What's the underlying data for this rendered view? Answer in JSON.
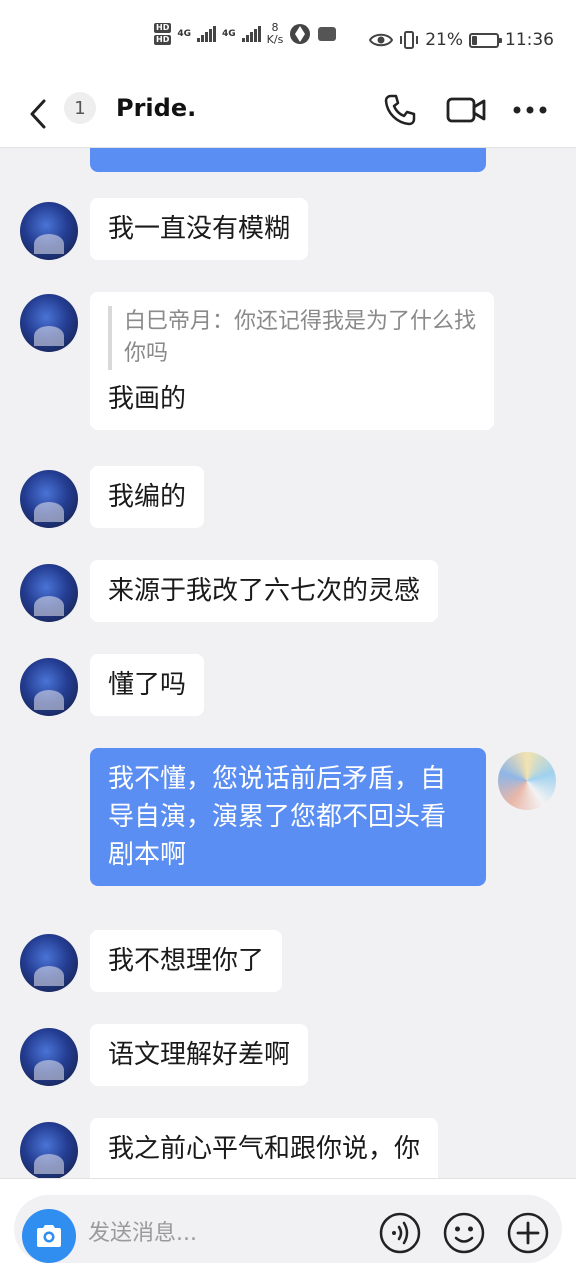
{
  "status_bar": {
    "hd1": "HD",
    "hd2": "HD",
    "net1": "4G",
    "net2": "4G",
    "speed_value": "8",
    "speed_unit": "K/s",
    "battery_percent": "21%",
    "battery_level": 0.21,
    "time": "11:36"
  },
  "header": {
    "unread_count": "1",
    "title": "Pride."
  },
  "messages": [
    {
      "sender": "other",
      "text": "我一直没有模糊"
    },
    {
      "sender": "other",
      "quote": "白巳帝月：你还记得我是为了什么找你吗",
      "text": "我画的"
    },
    {
      "sender": "other",
      "text": "我编的"
    },
    {
      "sender": "other",
      "text": "来源于我改了六七次的灵感"
    },
    {
      "sender": "other",
      "text": "懂了吗"
    },
    {
      "sender": "me",
      "text": "我不懂，您说话前后矛盾，自导自演，演累了您都不回头看剧本啊"
    },
    {
      "sender": "other",
      "text": "我不想理你了"
    },
    {
      "sender": "other",
      "text": "语文理解好差啊"
    },
    {
      "sender": "other",
      "text": "我之前心平气和跟你说，你"
    }
  ],
  "input": {
    "placeholder": "发送消息..."
  },
  "colors": {
    "my_bubble": "#5b8ef2",
    "camera_button": "#2f8ef0",
    "background": "#f1f1f3"
  },
  "icons": [
    "back-chevron-icon",
    "phone-icon",
    "video-camera-icon",
    "more-dots-icon",
    "camera-icon",
    "voice-icon",
    "emoji-icon",
    "plus-icon"
  ]
}
